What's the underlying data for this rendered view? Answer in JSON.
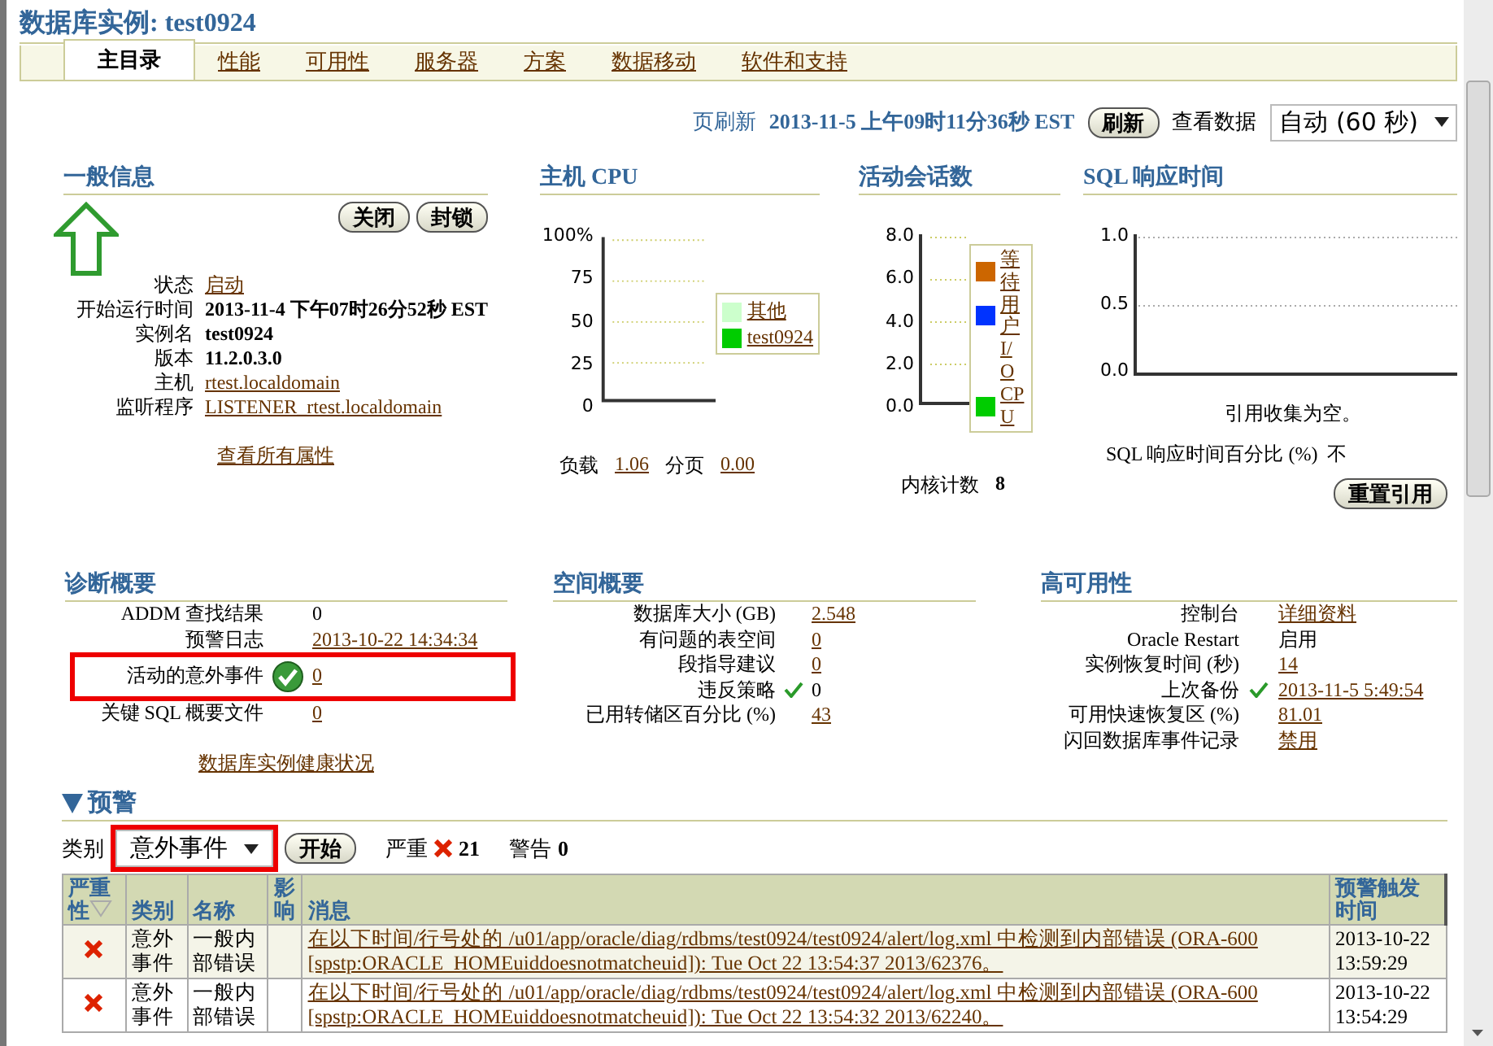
{
  "page_title": "数据库实例: test0924",
  "tabs": [
    {
      "label": "主目录",
      "selected": true
    },
    {
      "label": "性能",
      "selected": false
    },
    {
      "label": "可用性",
      "selected": false
    },
    {
      "label": "服务器",
      "selected": false
    },
    {
      "label": "方案",
      "selected": false
    },
    {
      "label": "数据移动",
      "selected": false
    },
    {
      "label": "软件和支持",
      "selected": false
    }
  ],
  "refresh": {
    "label": "页刷新",
    "timestamp": "2013-11-5 上午09时11分36秒  EST",
    "button": "刷新",
    "view_label": "查看数据",
    "view_value": "自动 (60 秒)"
  },
  "general": {
    "title": "一般信息",
    "buttons": [
      "关闭",
      "封锁"
    ],
    "rows": [
      {
        "label": "状态",
        "value": "启动",
        "kind": "link"
      },
      {
        "label": "开始运行时间",
        "value": "2013-11-4 下午07时26分52秒  EST",
        "kind": "bold"
      },
      {
        "label": "实例名",
        "value": "test0924",
        "kind": "bold"
      },
      {
        "label": "版本",
        "value": "11.2.0.3.0",
        "kind": "bold"
      },
      {
        "label": "主机",
        "value": "rtest.localdomain",
        "kind": "link"
      },
      {
        "label": "监听程序",
        "value": "LISTENER_rtest.localdomain",
        "kind": "link"
      }
    ],
    "all_link": "查看所有属性"
  },
  "cpu": {
    "title": "主机  CPU",
    "y_labels": [
      "100%",
      "75",
      "50",
      "25",
      "0"
    ],
    "legend": [
      {
        "label": "其他",
        "color": "#ccffcc"
      },
      {
        "label": "test0924",
        "color": "#00cc00"
      }
    ],
    "stats": [
      {
        "label": "负载",
        "value": "1.06"
      },
      {
        "label": "分页",
        "value": "0.00"
      }
    ]
  },
  "sessions": {
    "title": "活动会话数",
    "y_labels": [
      "8.0",
      "6.0",
      "4.0",
      "2.0",
      "0.0"
    ],
    "legend": [
      {
        "label": "等待",
        "color": "#cc6600"
      },
      {
        "label": "用户",
        "color": "#0033ff"
      },
      {
        "label": "I/O"
      },
      {
        "label": "CPU",
        "color": "#00cc00"
      }
    ],
    "core_label": "内核计数",
    "core_value": "8"
  },
  "sql": {
    "title": "SQL 响应时间",
    "y_labels": [
      "1.0",
      "0.5",
      "0.0"
    ],
    "empty_note": "引用收集为空。",
    "percent_label": "SQL 响应时间百分比 (%)",
    "percent_value": "不",
    "reset_button": "重置引用"
  },
  "diagnostics": {
    "title": "诊断概要",
    "rows": [
      {
        "label": "ADDM 查找结果",
        "value": "0",
        "kind": "text",
        "ok": false,
        "highlighted": false
      },
      {
        "label": "预警日志",
        "value": "2013-10-22 14:34:34",
        "kind": "link",
        "ok": false,
        "highlighted": false
      },
      {
        "label": "活动的意外事件",
        "value": "0",
        "kind": "link",
        "ok": true,
        "highlighted": true
      },
      {
        "label": "关键 SQL 概要文件",
        "value": "0",
        "kind": "link",
        "ok": false,
        "highlighted": false
      }
    ],
    "health_link": "数据库实例健康状况"
  },
  "space": {
    "title": "空间概要",
    "rows": [
      {
        "label": "数据库大小 (GB)",
        "value": "2.548",
        "kind": "link",
        "ok": false
      },
      {
        "label": "有问题的表空间",
        "value": "0",
        "kind": "link",
        "ok": false
      },
      {
        "label": "段指导建议",
        "value": "0",
        "kind": "link",
        "ok": false
      },
      {
        "label": "违反策略",
        "value": "0",
        "kind": "text",
        "ok": true
      },
      {
        "label": "已用转储区百分比 (%)",
        "value": "43",
        "kind": "link",
        "ok": false
      }
    ]
  },
  "availability": {
    "title": "高可用性",
    "rows": [
      {
        "label": "控制台",
        "value": "详细资料",
        "kind": "link",
        "ok": false
      },
      {
        "label": "Oracle Restart",
        "value": "启用",
        "kind": "text",
        "ok": false
      },
      {
        "label": "实例恢复时间 (秒)",
        "value": "14",
        "kind": "link",
        "ok": false
      },
      {
        "label": "上次备份",
        "value": "2013-11-5 5:49:54",
        "kind": "link",
        "ok": true
      },
      {
        "label": "可用快速恢复区 (%)",
        "value": "81.01",
        "kind": "link",
        "ok": false
      },
      {
        "label": "闪回数据库事件记录",
        "value": "禁用",
        "kind": "link",
        "ok": false
      }
    ]
  },
  "alerts": {
    "title": "预警",
    "expanded": true,
    "category_label": "类别",
    "category_value": "意外事件",
    "category_highlighted": true,
    "go_button": "开始",
    "critical_label": "严重",
    "critical_count": "21",
    "warning_label": "警告",
    "warning_count": "0",
    "columns": [
      "严重性",
      "类别",
      "名称",
      "影响",
      "消息",
      "预警触发时间"
    ],
    "rows": [
      {
        "kind": "critical",
        "category": "意外事件",
        "name": "一般内部错误",
        "impact": "",
        "message": "在以下时间/行号处的  /u01/app/oracle/diag/rdbms/test0924/test0924/alert/log.xml 中检测到内部错误  (ORA-600 [spstp:ORACLE_HOMEuiddoesnotmatcheuid]): Tue Oct 22 13:54:37 2013/62376。",
        "time": "2013-10-22 13:59:29"
      },
      {
        "kind": "critical",
        "category": "意外事件",
        "name": "一般内部错误",
        "impact": "",
        "message": "在以下时间/行号处的  /u01/app/oracle/diag/rdbms/test0924/test0924/alert/log.xml 中检测到内部错误  (ORA-600 [spstp:ORACLE_HOMEuiddoesnotmatcheuid]): Tue Oct 22 13:54:32 2013/62240。",
        "time": "2013-10-22 13:54:29"
      }
    ]
  }
}
